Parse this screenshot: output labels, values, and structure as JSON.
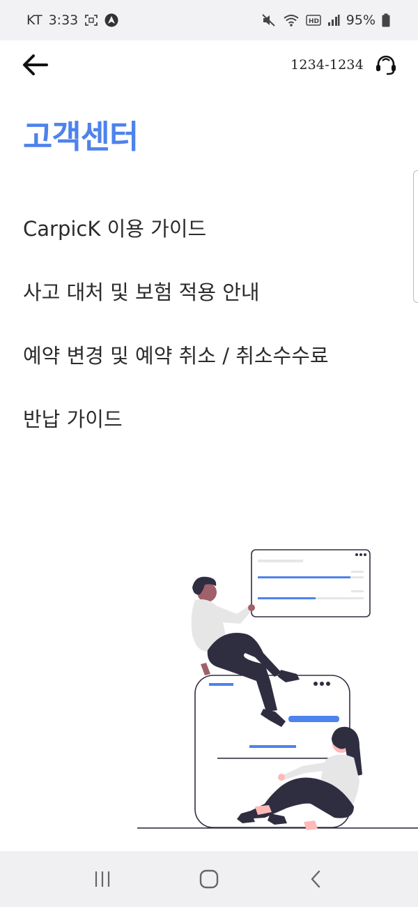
{
  "status_bar": {
    "carrier": "KT",
    "time": "3:33",
    "battery": "95%",
    "icons": [
      "screenshot-icon",
      "navigation-app-icon",
      "mute-icon",
      "wifi-icon",
      "hd-voice-icon",
      "signal-icon",
      "battery-icon"
    ]
  },
  "app_bar": {
    "back_icon": "arrow-left-icon",
    "phone_number": "1234-1234",
    "support_icon": "headset-icon"
  },
  "page": {
    "title": "고객센터"
  },
  "menu": {
    "items": [
      {
        "label": "CarpicK 이용 가이드"
      },
      {
        "label": "사고 대처 및 보험 적용 안내"
      },
      {
        "label": "예약 변경 및 예약 취소 / 취소수수료"
      },
      {
        "label": "반납 가이드"
      }
    ]
  },
  "colors": {
    "accent": "#4e82ec",
    "text": "#2b2b2b",
    "status_bg": "#f2f2f4",
    "nav_bg": "#f0f0f2"
  },
  "nav_bar": {
    "icons": [
      "recent-apps-icon",
      "home-icon",
      "back-icon"
    ]
  }
}
